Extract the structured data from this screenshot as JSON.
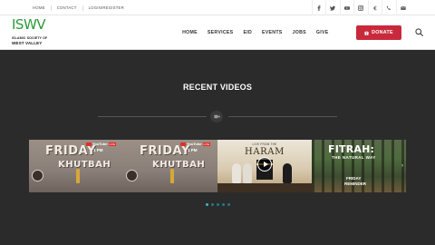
{
  "topbar": {
    "links": [
      "HOME",
      "CONTACT",
      "LOGIN/REGISTER"
    ],
    "social_icons": [
      "facebook-icon",
      "twitter-icon",
      "youtube-icon",
      "instagram-icon",
      "euro-icon",
      "phone-icon",
      "envelope-icon"
    ]
  },
  "header": {
    "logo": {
      "mark": "ISWV",
      "line1": "ISLAMIC SOCIETY OF",
      "line2": "WEST VALLEY"
    },
    "nav": [
      "HOME",
      "SERVICES",
      "EID",
      "EVENTS",
      "JOBS",
      "GIVE"
    ],
    "donate_label": "DONATE",
    "accent_color": "#c92a3b"
  },
  "main": {
    "section_title": "RECENT VIDEOS",
    "badge_icon": "video-camera-icon",
    "slides": [
      {
        "line1": "FRIDAY",
        "line2": "KHUTBAH",
        "youtube": "YouTube",
        "live": "LIVE",
        "time": "1 PM"
      },
      {
        "line1": "FRIDAY",
        "line2": "KHUTBAH",
        "youtube": "YouTube",
        "live": "LIVE",
        "time": "1 PM"
      },
      {
        "top": "LIVE FROM THE",
        "title": "HARAM"
      },
      {
        "title": "FITRAH:",
        "subtitle": "THE NATURAL WAY",
        "line1": "FRIDAY",
        "line2": "REMINDER"
      }
    ],
    "dots": 5,
    "active_dot": 0
  }
}
